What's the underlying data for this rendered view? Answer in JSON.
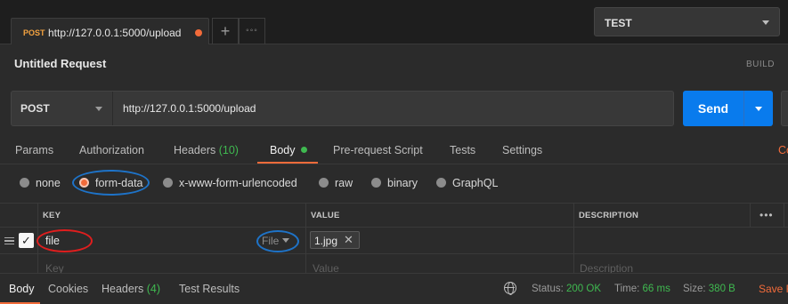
{
  "tab": {
    "method": "POST",
    "url": "http://127.0.0.1:5000/upload",
    "more": "◦◦◦"
  },
  "environment": {
    "selected": "TEST"
  },
  "request": {
    "title": "Untitled Request",
    "build_label": "BUILD",
    "method": "POST",
    "url": "http://127.0.0.1:5000/upload",
    "send_label": "Send"
  },
  "subtabs": {
    "params": "Params",
    "authorization": "Authorization",
    "headers": "Headers",
    "headers_count": "(10)",
    "body": "Body",
    "prerequest": "Pre-request Script",
    "tests": "Tests",
    "settings": "Settings",
    "cookies_edge": "Co"
  },
  "body_modes": {
    "selected": "form-data",
    "options": [
      "none",
      "form-data",
      "x-www-form-urlencoded",
      "raw",
      "binary",
      "GraphQL"
    ]
  },
  "table": {
    "headers": {
      "key": "KEY",
      "value": "VALUE",
      "description": "DESCRIPTION",
      "more": "•••"
    },
    "rows": [
      {
        "checked": true,
        "key": "file",
        "type": "File",
        "value": "1.jpg"
      }
    ],
    "placeholders": {
      "key": "Key",
      "value": "Value",
      "description": "Description"
    }
  },
  "response": {
    "tabs": {
      "body": "Body",
      "cookies": "Cookies",
      "headers": "Headers",
      "headers_count": "(4)",
      "test_results": "Test Results"
    },
    "status_label": "Status:",
    "status": "200 OK",
    "time_label": "Time:",
    "time": "66 ms",
    "size_label": "Size:",
    "size": "380 B",
    "save_label": "Save R"
  },
  "colors": {
    "accent": "#f26b3a",
    "send": "#097bed",
    "green": "#3fb950",
    "annotation_red": "#e01e1e",
    "annotation_blue": "#1e73c8"
  }
}
